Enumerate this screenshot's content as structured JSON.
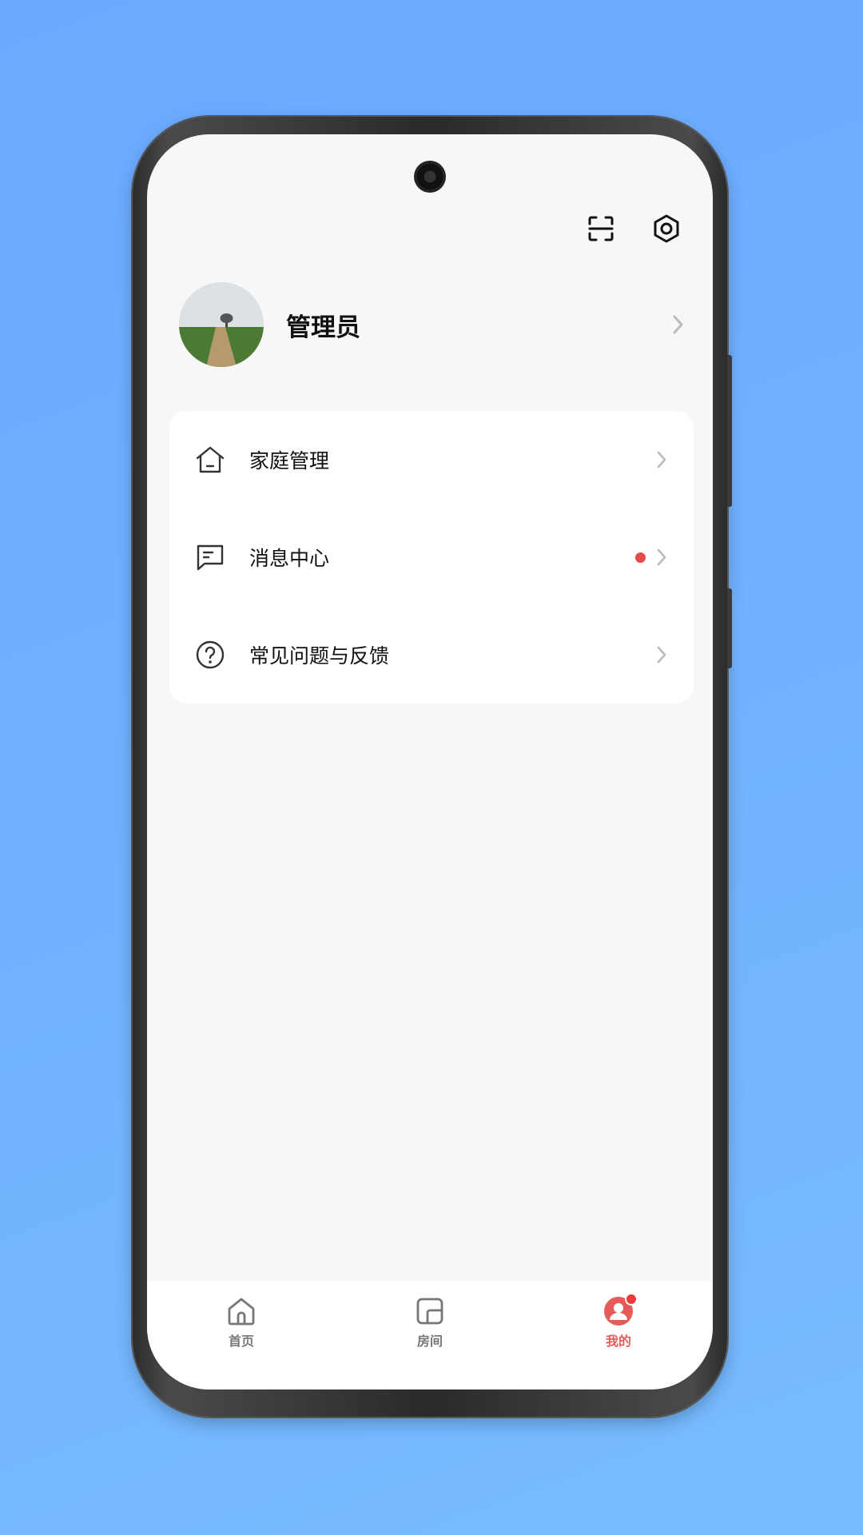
{
  "profile": {
    "name": "管理员"
  },
  "menu": {
    "items": [
      {
        "label": "家庭管理",
        "icon": "home-icon"
      },
      {
        "label": "消息中心",
        "icon": "message-icon",
        "has_unread": true
      },
      {
        "label": "常见问题与反馈",
        "icon": "help-icon"
      }
    ]
  },
  "top_actions": {
    "scan_icon": "scan-icon",
    "settings_icon": "settings-icon"
  },
  "tabbar": {
    "tabs": [
      {
        "label": "首页",
        "icon": "home-tab-icon"
      },
      {
        "label": "房间",
        "icon": "room-tab-icon"
      },
      {
        "label": "我的",
        "icon": "profile-tab-icon",
        "active": true
      }
    ]
  },
  "colors": {
    "accent": "#e65a5a",
    "badge": "#e64b4b",
    "background_gradient_start": "#6aa9ff",
    "screen_bg": "#f7f7f7"
  }
}
